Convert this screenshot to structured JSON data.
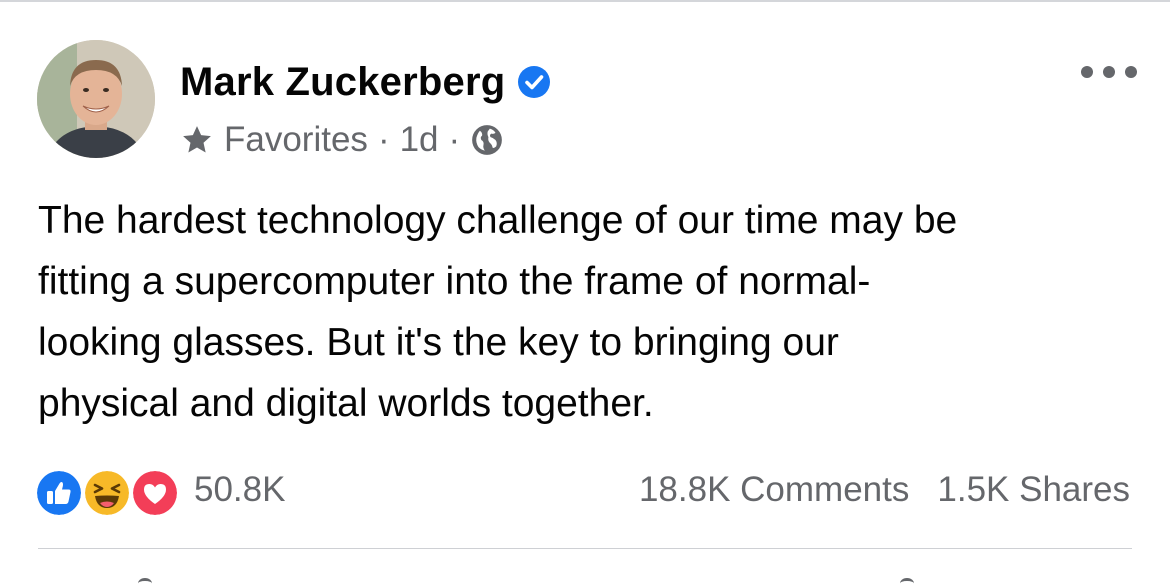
{
  "author": {
    "name": "Mark Zuckerberg",
    "verified": true
  },
  "meta": {
    "audience_label": "Favorites",
    "separator": "·",
    "time": "1d",
    "privacy_icon": "globe-icon"
  },
  "post": {
    "text_lines": [
      "The hardest technology challenge of our time may be",
      "fitting a supercomputer into the frame of normal-",
      "looking glasses. But it's the key to bringing our",
      "physical and digital worlds together."
    ]
  },
  "stats": {
    "reactions": [
      "like",
      "haha",
      "love"
    ],
    "reaction_count": "50.8K",
    "comments": "18.8K Comments",
    "shares": "1.5K Shares"
  },
  "colors": {
    "verified_blue": "#1877f2",
    "like_blue": "#1877f2",
    "haha_yellow": "#f7b928",
    "love_red": "#f33e58",
    "secondary_text": "#65676b"
  }
}
